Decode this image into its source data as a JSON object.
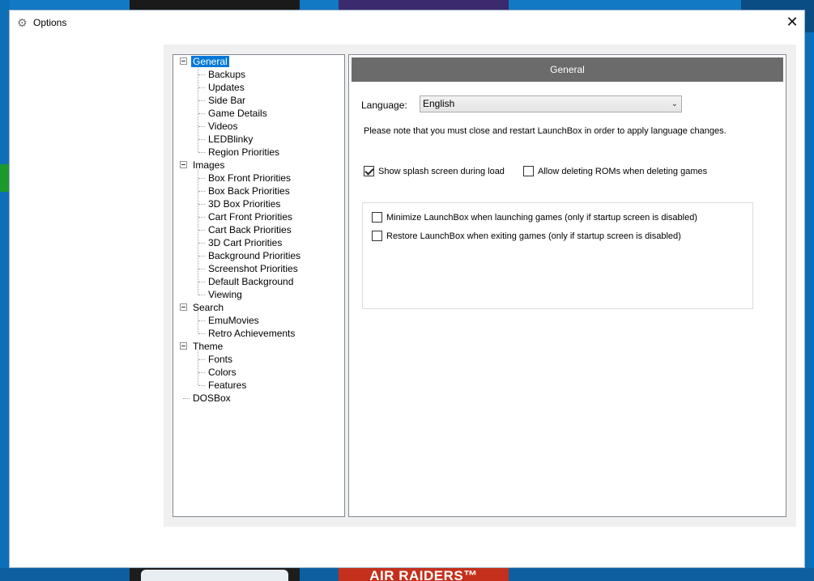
{
  "window": {
    "title": "Options",
    "close_glyph": "✕"
  },
  "background": {
    "bottom_tile_text": "AIR RAIDERS™"
  },
  "tree": {
    "nodes": [
      {
        "label": "General",
        "level": 0,
        "expanded": true,
        "selected": true
      },
      {
        "label": "Backups",
        "level": 1
      },
      {
        "label": "Updates",
        "level": 1
      },
      {
        "label": "Side Bar",
        "level": 1
      },
      {
        "label": "Game Details",
        "level": 1
      },
      {
        "label": "Videos",
        "level": 1
      },
      {
        "label": "LEDBlinky",
        "level": 1
      },
      {
        "label": "Region Priorities",
        "level": 1
      },
      {
        "label": "Images",
        "level": 0,
        "expanded": true
      },
      {
        "label": "Box Front Priorities",
        "level": 1
      },
      {
        "label": "Box Back Priorities",
        "level": 1
      },
      {
        "label": "3D Box Priorities",
        "level": 1
      },
      {
        "label": "Cart Front Priorities",
        "level": 1
      },
      {
        "label": "Cart Back Priorities",
        "level": 1
      },
      {
        "label": "3D Cart Priorities",
        "level": 1
      },
      {
        "label": "Background Priorities",
        "level": 1
      },
      {
        "label": "Screenshot Priorities",
        "level": 1
      },
      {
        "label": "Default Background",
        "level": 1
      },
      {
        "label": "Viewing",
        "level": 1
      },
      {
        "label": "Search",
        "level": 0,
        "expanded": true
      },
      {
        "label": "EmuMovies",
        "level": 1
      },
      {
        "label": "Retro Achievements",
        "level": 1
      },
      {
        "label": "Theme",
        "level": 0,
        "expanded": true
      },
      {
        "label": "Fonts",
        "level": 1
      },
      {
        "label": "Colors",
        "level": 1
      },
      {
        "label": "Features",
        "level": 1
      },
      {
        "label": "DOSBox",
        "level": 0
      }
    ]
  },
  "panel": {
    "header": "General",
    "language_label": "Language:",
    "language_value": "English",
    "language_note": "Please note that you must close and restart LaunchBox in order to apply language changes.",
    "checks": {
      "splash": {
        "label": "Show splash screen during load",
        "checked": true
      },
      "delete_roms": {
        "label": "Allow deleting ROMs when deleting games",
        "checked": false
      },
      "minimize": {
        "label": "Minimize LaunchBox when launching games (only if startup screen is disabled)",
        "checked": false
      },
      "restore": {
        "label": "Restore LaunchBox when exiting games (only if startup screen is disabled)",
        "checked": false
      }
    }
  },
  "icons": {
    "window_icon": "gear-icon",
    "dropdown": "chevron-down-icon",
    "close": "close-icon"
  }
}
